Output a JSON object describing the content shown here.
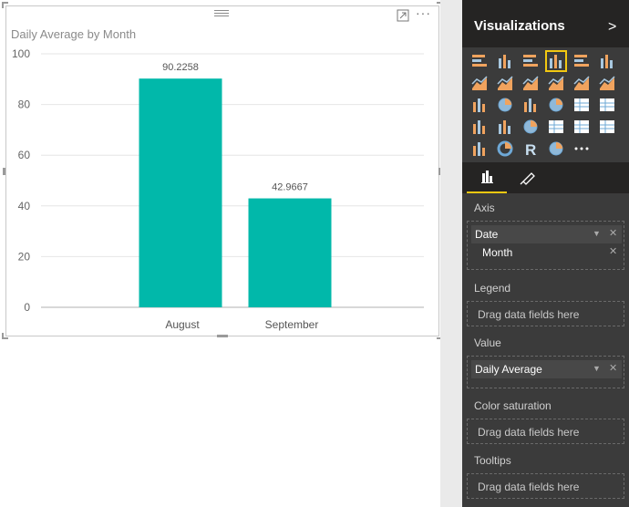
{
  "visual": {
    "title": "Daily Average by Month",
    "more_label": "···"
  },
  "chart_data": {
    "type": "bar",
    "title": "Daily Average by Month",
    "categories": [
      "August",
      "September"
    ],
    "series": [
      {
        "values": [
          90.2258,
          42.9667
        ]
      }
    ],
    "data_labels": [
      "90.2258",
      "42.9667"
    ],
    "y_ticks": [
      "0",
      "20",
      "40",
      "60",
      "80",
      "100"
    ],
    "ylim": [
      0,
      100
    ],
    "xlabel": "",
    "ylabel": "",
    "grid": true,
    "bar_color": "#01b8aa"
  },
  "pane": {
    "title": "Visualizations",
    "collapse_glyph": ">",
    "more_glyph": "···",
    "accent": "#f2c811",
    "icons": [
      "stacked-bar-icon",
      "stacked-column-icon",
      "clustered-bar-icon",
      "clustered-column-icon",
      "100-bar-icon",
      "100-column-icon",
      "line-chart-icon",
      "area-chart-icon",
      "stacked-area-icon",
      "line-column-icon",
      "line-clustered-column-icon",
      "ribbon-chart-icon",
      "scatter-chart-icon",
      "pie-chart-icon",
      "treemap-icon",
      "map-icon",
      "table-icon",
      "matrix-icon",
      "filled-map-icon",
      "funnel-icon",
      "gauge-icon",
      "multirow-card-icon",
      "card-icon",
      "kpi-icon",
      "slicer-icon",
      "donut-icon",
      "r-visual-icon",
      "globe-icon",
      "more-visuals-icon"
    ],
    "selected_icon": "clustered-column-icon",
    "tabs": [
      "fields-tab",
      "format-tab"
    ]
  },
  "wells": {
    "axis": {
      "label": "Axis",
      "group": "Date",
      "field": "Month"
    },
    "legend": {
      "label": "Legend",
      "placeholder": "Drag data fields here"
    },
    "value": {
      "label": "Value",
      "field": "Daily Average"
    },
    "color_saturation": {
      "label": "Color saturation",
      "placeholder": "Drag data fields here"
    },
    "tooltips": {
      "label": "Tooltips",
      "placeholder": "Drag data fields here"
    }
  }
}
